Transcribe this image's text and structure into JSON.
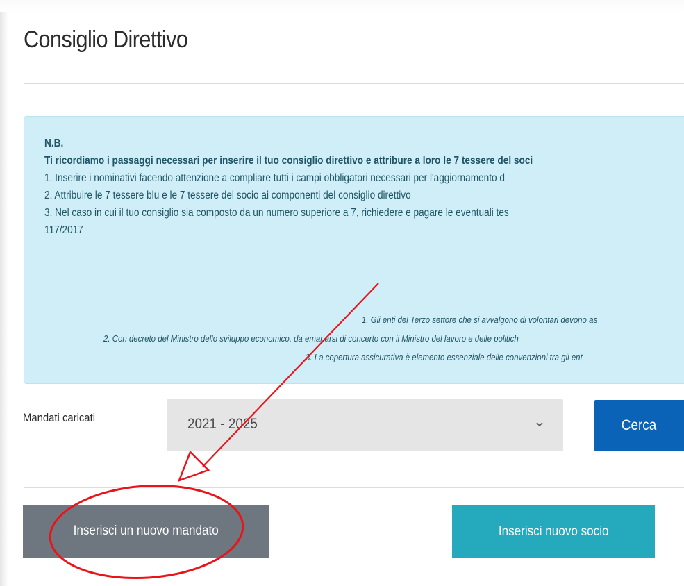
{
  "page": {
    "title": "Consiglio Direttivo"
  },
  "notice": {
    "heading": "N.B.",
    "intro": "Ti ricordiamo i passaggi necessari per inserire il tuo consiglio direttivo e attribure a loro le 7 tessere del soci",
    "steps": [
      "1. Inserire i nominativi facendo attenzione a compliare tutti i campi obbligatori necessari per l'aggiornamento d",
      "2. Attribuire le 7 tessere blu e le 7 tessere del socio ai componenti del consiglio direttivo",
      "3. Nel caso in cui il tuo consiglio sia composto da un numero superiore a 7, richiedere e pagare le eventuali tes"
    ],
    "steps_cont": "117/2017",
    "quotes": [
      "1. Gli enti del Terzo settore che si avvalgono di volontari devono as",
      "2. Con decreto del Ministro dello sviluppo economico, da emanarsi di concerto con il Ministro del lavoro e delle politich",
      "3. La copertura assicurativa è elemento essenziale delle convenzioni tra gli ent"
    ]
  },
  "filter": {
    "label": "Mandati caricati",
    "selected": "2021 - 2025",
    "search_button": "Cerca"
  },
  "actions": {
    "new_mandate": "Inserisci un nuovo mandato",
    "new_member": "Inserisci nuovo socio"
  },
  "colors": {
    "notice_bg": "#cfeef7",
    "search_button": "#0a63b7",
    "new_mandate_button": "#6e7780",
    "new_member_button": "#24a9bd",
    "annotation": "#e8141a"
  },
  "icons": {
    "select_chevron": "chevron-down-icon"
  }
}
